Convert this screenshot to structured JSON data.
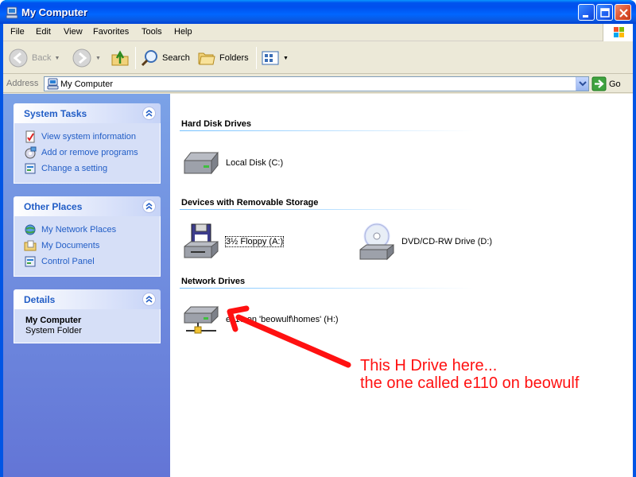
{
  "window": {
    "title": "My Computer"
  },
  "menu": [
    "File",
    "Edit",
    "View",
    "Favorites",
    "Tools",
    "Help"
  ],
  "toolbar": {
    "back": "Back",
    "search": "Search",
    "folders": "Folders"
  },
  "address": {
    "label": "Address",
    "value": "My Computer",
    "go": "Go"
  },
  "system_tasks": {
    "title": "System Tasks",
    "items": [
      "View system information",
      "Add or remove programs",
      "Change a setting"
    ]
  },
  "other_places": {
    "title": "Other Places",
    "items": [
      "My Network Places",
      "My Documents",
      "Control Panel"
    ]
  },
  "details": {
    "title": "Details",
    "name": "My Computer",
    "type": "System Folder"
  },
  "groups": {
    "hard_disk": {
      "title": "Hard Disk Drives",
      "items": [
        "Local Disk (C:)"
      ]
    },
    "removable": {
      "title": "Devices with Removable Storage",
      "items": [
        "3½ Floppy (A:)",
        "DVD/CD-RW Drive (D:)"
      ]
    },
    "network": {
      "title": "Network Drives",
      "items": [
        "e110 on 'beowulf\\homes' (H:)"
      ]
    }
  },
  "annotation": {
    "line1": "This H Drive here...",
    "line2": "the one called e110 on beowulf",
    "color": "#ff1111"
  },
  "colors": {
    "title_bar": "#0055e5",
    "task_pane": "#6f8edf",
    "link": "#215dc6"
  }
}
